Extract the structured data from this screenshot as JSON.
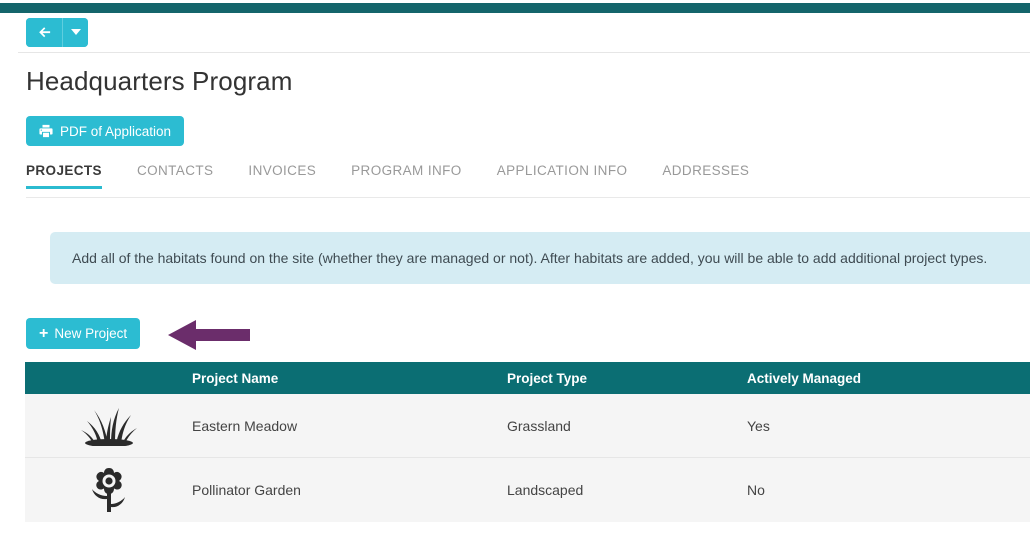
{
  "topbar": {
    "color": "#14656b"
  },
  "nav": {
    "back_icon": "arrow-left-icon",
    "dropdown_icon": "caret-down-icon",
    "accent": "#2cbcd2"
  },
  "header": {
    "title": "Headquarters Program",
    "pdf_button_label": "PDF of Application",
    "pdf_button_icon": "printer-icon"
  },
  "tabs": [
    {
      "label": "PROJECTS",
      "active": true
    },
    {
      "label": "CONTACTS",
      "active": false
    },
    {
      "label": "INVOICES",
      "active": false
    },
    {
      "label": "PROGRAM INFO",
      "active": false
    },
    {
      "label": "APPLICATION INFO",
      "active": false
    },
    {
      "label": "ADDRESSES",
      "active": false
    }
  ],
  "alert": {
    "text": "Add all of the habitats found on the site (whether they are managed or not). After habitats are added, you will be able to add additional project types.",
    "background": "#d5ecf3"
  },
  "actions": {
    "new_project_label": "New Project",
    "new_project_plus": "+"
  },
  "annotation": {
    "arrow_direction": "left",
    "color": "#6b2d6b"
  },
  "table": {
    "header_color": "#0b6e73",
    "columns": [
      "",
      "Project Name",
      "Project Type",
      "Actively Managed"
    ],
    "rows": [
      {
        "icon": "grass-icon",
        "name": "Eastern Meadow",
        "type": "Grassland",
        "managed": "Yes"
      },
      {
        "icon": "flower-icon",
        "name": "Pollinator Garden",
        "type": "Landscaped",
        "managed": "No"
      }
    ]
  }
}
